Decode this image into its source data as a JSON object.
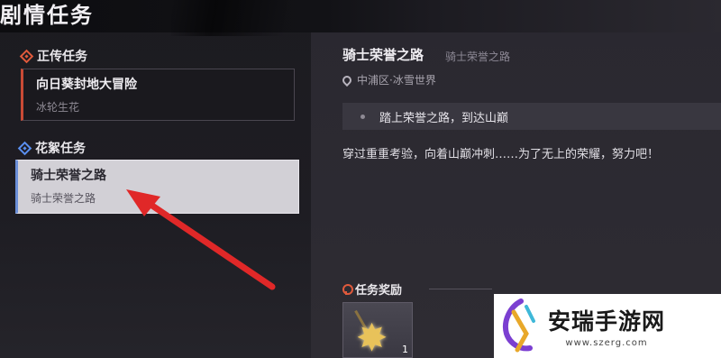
{
  "header": {
    "title": "剧情任务"
  },
  "sections": {
    "main": {
      "label": "正传任务"
    },
    "side": {
      "label": "花絮任务"
    }
  },
  "quests": {
    "main": {
      "title": "向日葵封地大冒险",
      "subtitle": "冰轮生花"
    },
    "side": {
      "title": "骑士荣誉之路",
      "subtitle": "骑士荣誉之路"
    }
  },
  "detail": {
    "title": "骑士荣誉之路",
    "subtitle": "骑士荣誉之路",
    "location": "中浦区·冰雪世界",
    "objective": "踏上荣誉之路，到达山巅",
    "description": "穿过重重考验，向着山巅冲刺……为了无上的荣耀，努力吧！"
  },
  "reward": {
    "label": "任务奖励",
    "item_count": "1"
  },
  "watermark": {
    "name": "安瑞手游网",
    "url": "www.szerg.com"
  },
  "colors": {
    "main_accent": "#c94a35",
    "side_accent": "#6b8fd8",
    "arrow": "#e02828"
  }
}
